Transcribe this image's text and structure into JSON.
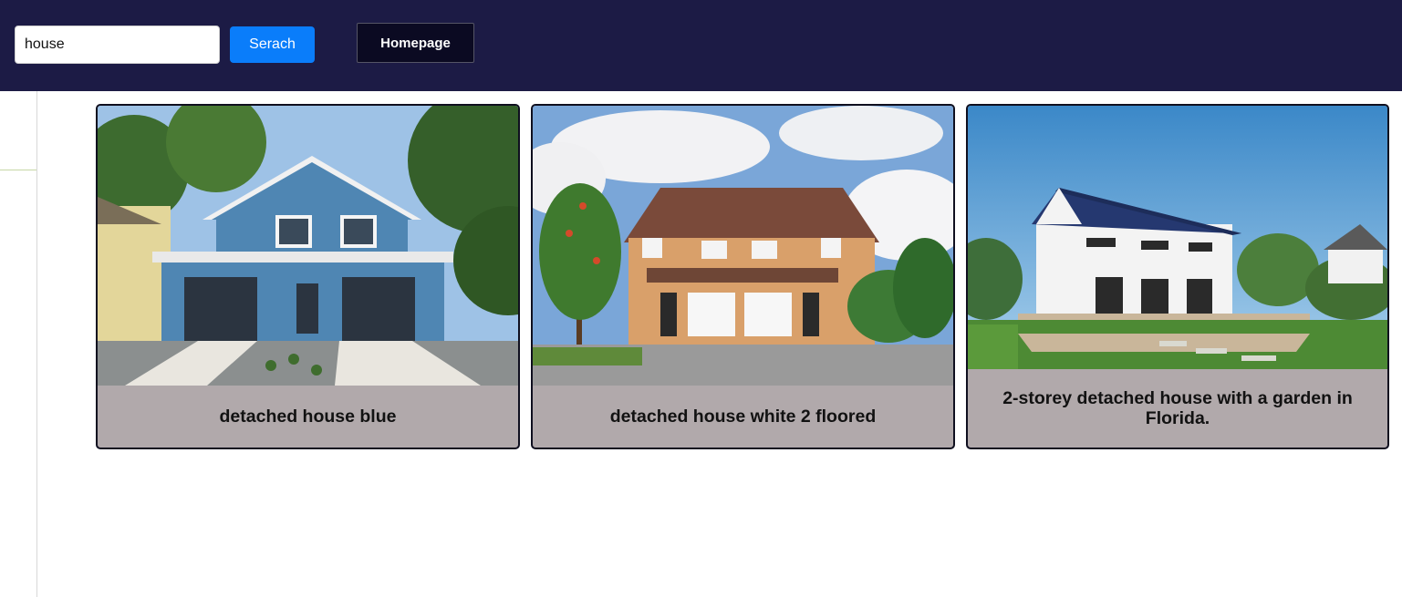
{
  "header": {
    "search": {
      "value": "house",
      "placeholder": ""
    },
    "search_button_label": "Serach",
    "homepage_button_label": "Homepage"
  },
  "results": [
    {
      "caption": "detached house blue",
      "image_icon": "blue-two-storey-house-photo"
    },
    {
      "caption": "detached house white 2 floored",
      "image_icon": "brick-semi-detached-house-photo"
    },
    {
      "caption": "2-storey detached house with a garden in Florida.",
      "image_icon": "white-house-solar-roof-photo"
    }
  ],
  "colors": {
    "header_bg": "#1c1b45",
    "search_button": "#0a7dfa",
    "homepage_button": "#0b0a22",
    "card_caption_bg": "#b1a9ab"
  }
}
